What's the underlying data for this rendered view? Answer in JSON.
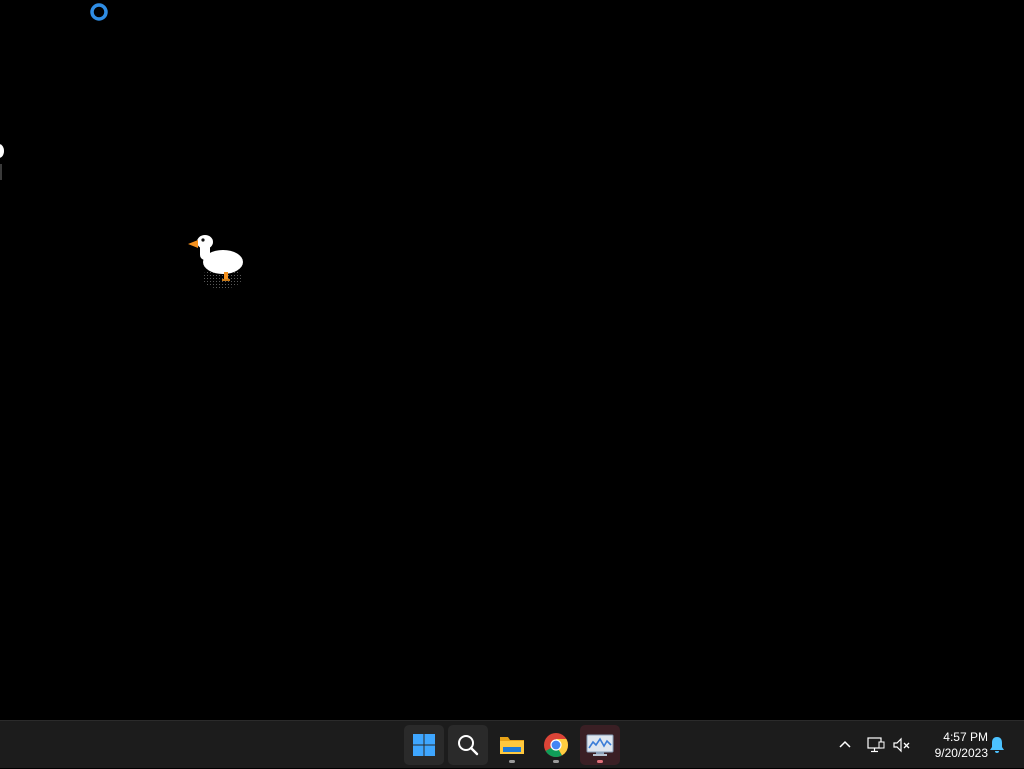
{
  "desktop": {
    "background_color": "#000000",
    "busy_cursor": "loading-ring-icon",
    "pet": "desktop-goose-icon"
  },
  "taskbar": {
    "apps": [
      {
        "name": "Start",
        "icon": "windows-start-icon",
        "running": false
      },
      {
        "name": "Search",
        "icon": "search-icon",
        "running": false
      },
      {
        "name": "File Explorer",
        "icon": "folder-icon",
        "running": true
      },
      {
        "name": "Google Chrome",
        "icon": "chrome-icon",
        "running": true
      },
      {
        "name": "Desktop Goose",
        "icon": "monitor-chart-icon",
        "running": true,
        "active": true
      }
    ],
    "tray": {
      "icons": [
        "chevron-up-icon",
        "network-icon",
        "volume-muted-icon",
        "notification-bell-icon"
      ],
      "time": "4:57 PM",
      "date": "9/20/2023"
    }
  },
  "colors": {
    "accent": "#0078d4",
    "taskbar": "#1c1c1c"
  }
}
